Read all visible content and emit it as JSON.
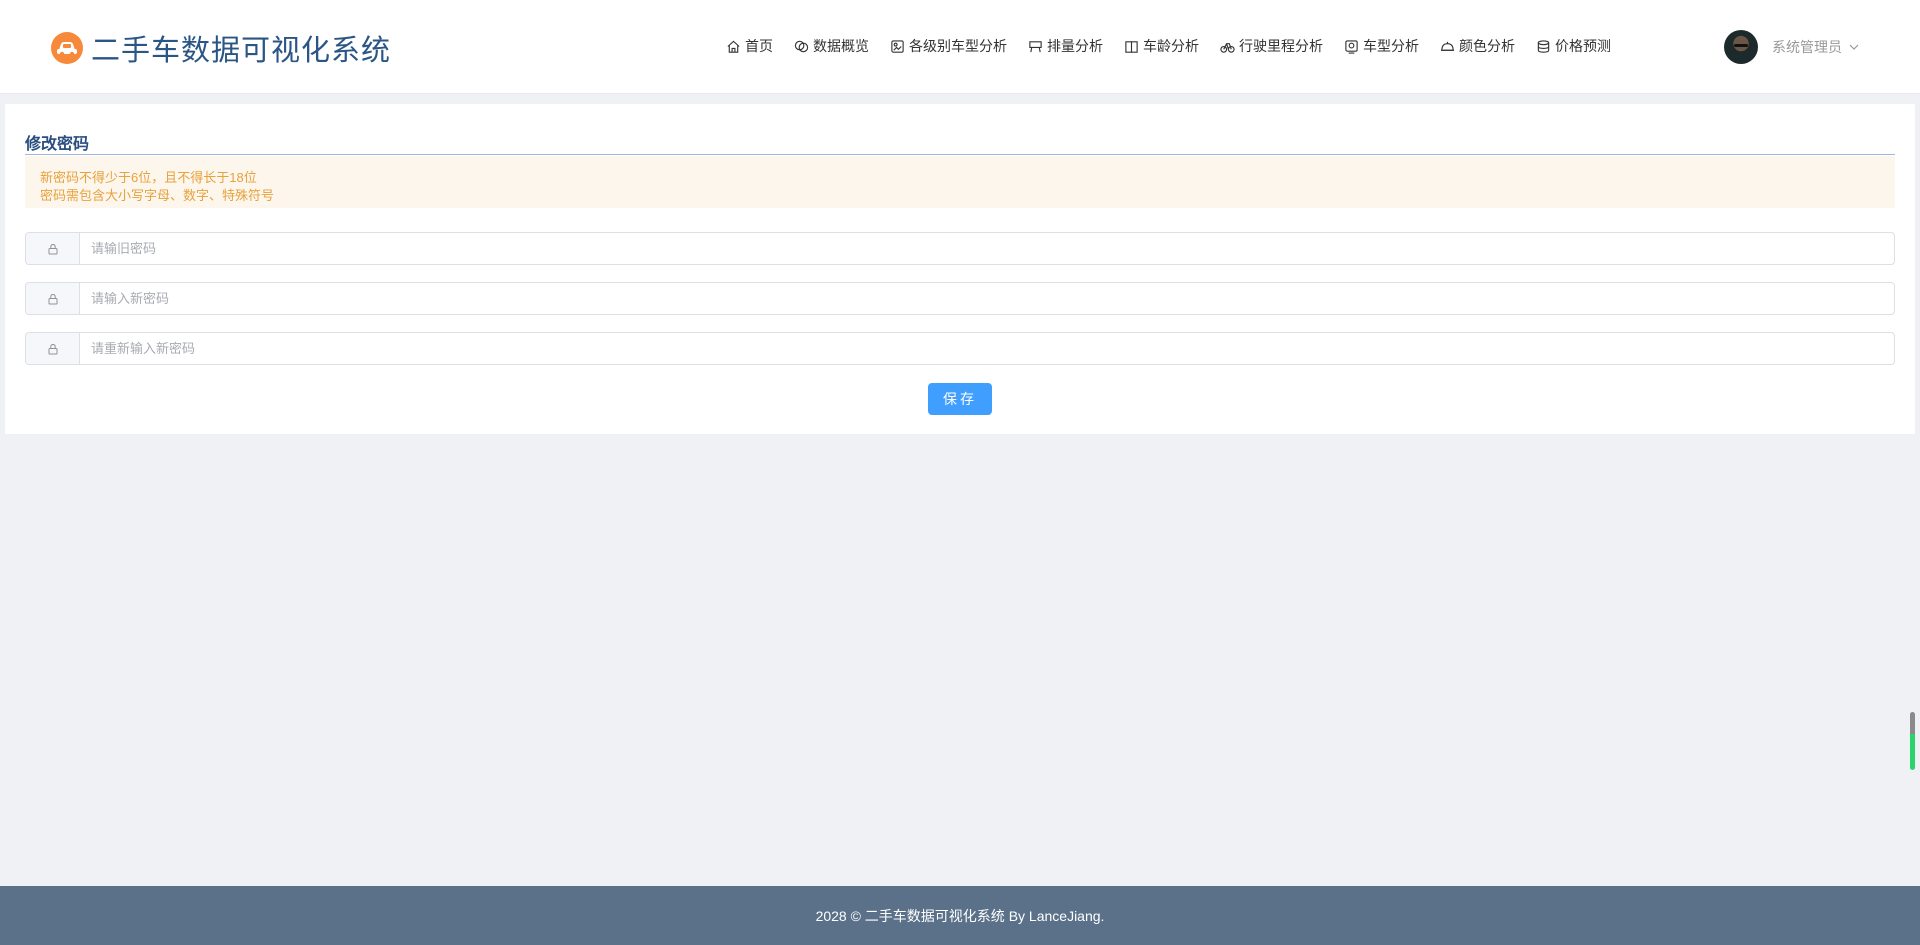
{
  "brand": {
    "title": "二手车数据可视化系统"
  },
  "nav": {
    "items": [
      {
        "label": "首页",
        "icon": "home-icon"
      },
      {
        "label": "数据概览",
        "icon": "overview-icon"
      },
      {
        "label": "各级别车型分析",
        "icon": "level-icon"
      },
      {
        "label": "排量分析",
        "icon": "displacement-icon"
      },
      {
        "label": "车龄分析",
        "icon": "age-icon"
      },
      {
        "label": "行驶里程分析",
        "icon": "bicycle-icon"
      },
      {
        "label": "车型分析",
        "icon": "model-icon"
      },
      {
        "label": "颜色分析",
        "icon": "color-icon"
      },
      {
        "label": "价格预测",
        "icon": "coins-icon"
      }
    ]
  },
  "user": {
    "name": "系统管理员"
  },
  "form": {
    "title": "修改密码",
    "notice": {
      "line1": "新密码不得少于6位，且不得长于18位",
      "line2": "密码需包含大小写字母、数字、特殊符号"
    },
    "old_password": {
      "placeholder": "请输旧密码"
    },
    "new_password": {
      "placeholder": "请输入新密码"
    },
    "confirm_password": {
      "placeholder": "请重新输入新密码"
    },
    "save_label": "保存"
  },
  "footer": {
    "text": "2028 © 二手车数据可视化系统 By LanceJiang."
  },
  "colors": {
    "accent": "#409eff",
    "brand_title": "#2a5585",
    "logo": "#f7893a",
    "notice_text": "#e6a23c",
    "notice_bg": "#fdf6ec",
    "footer_bg": "#5a7189"
  }
}
